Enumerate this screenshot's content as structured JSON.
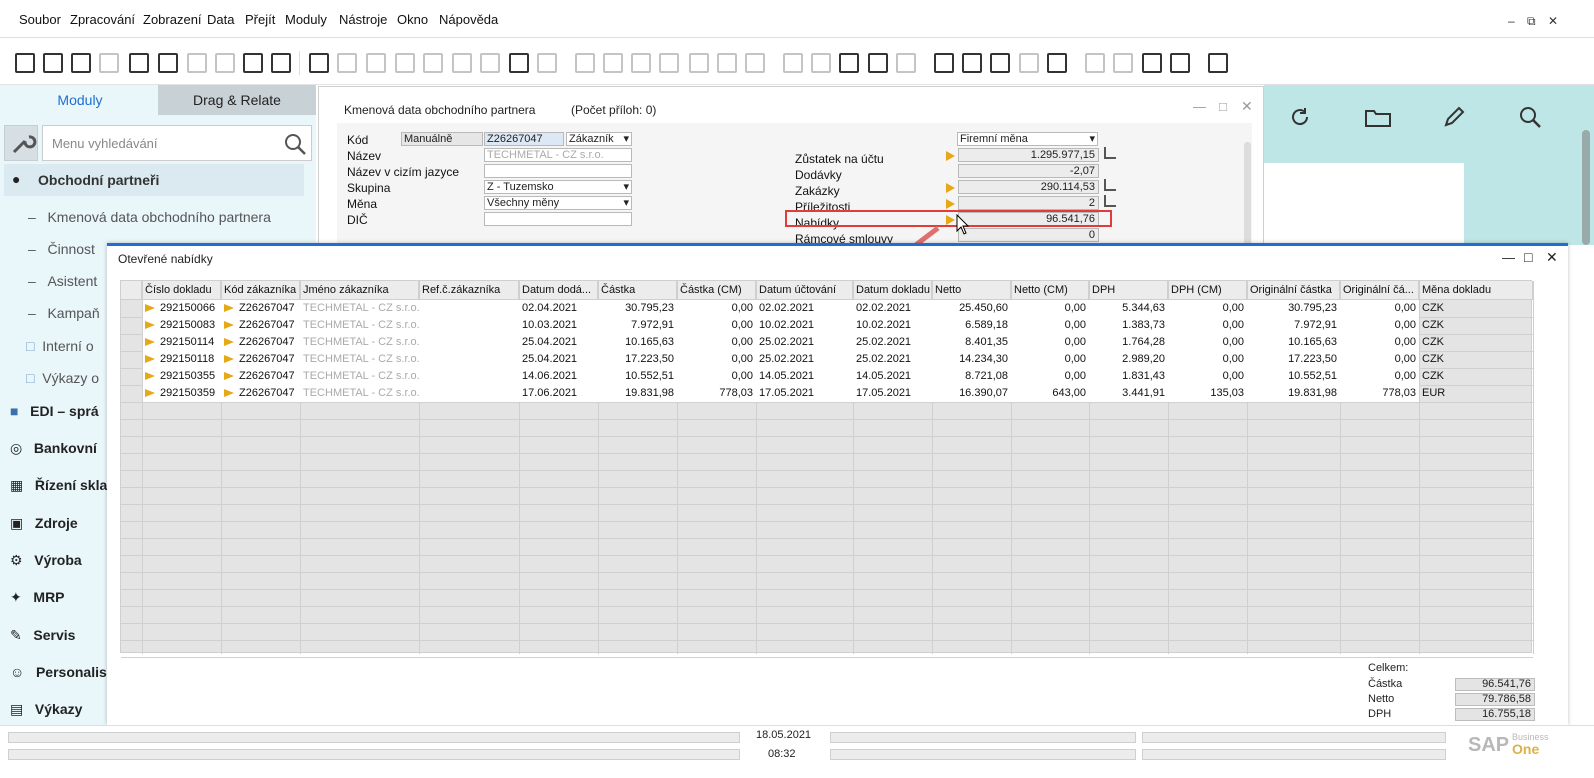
{
  "menu": [
    "Soubor",
    "Zpracování",
    "Zobrazení",
    "Data",
    "Přejít",
    "Moduly",
    "Nástroje",
    "Okno",
    "Nápověda"
  ],
  "window_controls": {
    "minimize": "–",
    "restore": "⧉",
    "close": "✕"
  },
  "sidebar": {
    "tab_modules": "Moduly",
    "tab_drag": "Drag & Relate",
    "search_placeholder": "Menu vyhledávání",
    "module": "Obchodní partneři",
    "sub_items": [
      "Kmenová data obchodního partnera",
      "Činnost",
      "Asistent",
      "Kampaň"
    ],
    "folders": [
      "Interní o",
      "Výkazy o"
    ],
    "modules": [
      "EDI – sprá",
      "Bankovní",
      "Řízení skla",
      "Zdroje",
      "Výroba",
      "MRP",
      "Servis",
      "Personalis",
      "Výkazy"
    ]
  },
  "bp_window": {
    "title": "Kmenová data obchodního partnera",
    "attachments": "(Počet příloh: 0)",
    "labels": {
      "kod": "Kód",
      "nazev": "Název",
      "nazev_cizi": "Název v cizím jazyce",
      "skupina": "Skupina",
      "mena": "Měna",
      "dic": "DIČ"
    },
    "values": {
      "manual": "Manuálně",
      "kod": "Z26267047",
      "typ": "Zákazník",
      "nazev": "TECHMETAL - CZ s.r.o.",
      "skupina": "Z - Tuzemsko",
      "mena": "Všechny měny"
    },
    "currency_select": "Firemní měna",
    "balances": [
      {
        "label": "Zůstatek na účtu",
        "value": "1.295.977,15"
      },
      {
        "label": "Dodávky",
        "value": "-2,07"
      },
      {
        "label": "Zakázky",
        "value": "290.114,53"
      },
      {
        "label": "Příležitosti",
        "value": "2"
      },
      {
        "label": "Nabídky",
        "value": "96.541,76"
      },
      {
        "label": "Rámcové smlouvy",
        "value": "0"
      }
    ]
  },
  "offers_window": {
    "title": "Otevřené nabídky",
    "columns": [
      "Číslo dokladu",
      "Kód zákazníka",
      "Jméno zákazníka",
      "Ref.č.zákazníka",
      "Datum dodá...",
      "Částka",
      "Částka (CM)",
      "Datum účtování",
      "Datum dokladu",
      "Netto",
      "Netto (CM)",
      "DPH",
      "DPH (CM)",
      "Originální částka",
      "Originální čá...",
      "Měna dokladu"
    ],
    "rows": [
      [
        "292150066",
        "Z26267047",
        "TECHMETAL - CZ s.r.o.",
        "",
        "02.04.2021",
        "30.795,23",
        "0,00",
        "02.02.2021",
        "02.02.2021",
        "25.450,60",
        "0,00",
        "5.344,63",
        "0,00",
        "30.795,23",
        "0,00",
        "CZK"
      ],
      [
        "292150083",
        "Z26267047",
        "TECHMETAL - CZ s.r.o.",
        "",
        "10.03.2021",
        "7.972,91",
        "0,00",
        "10.02.2021",
        "10.02.2021",
        "6.589,18",
        "0,00",
        "1.383,73",
        "0,00",
        "7.972,91",
        "0,00",
        "CZK"
      ],
      [
        "292150114",
        "Z26267047",
        "TECHMETAL - CZ s.r.o.",
        "",
        "25.04.2021",
        "10.165,63",
        "0,00",
        "25.02.2021",
        "25.02.2021",
        "8.401,35",
        "0,00",
        "1.764,28",
        "0,00",
        "10.165,63",
        "0,00",
        "CZK"
      ],
      [
        "292150118",
        "Z26267047",
        "TECHMETAL - CZ s.r.o.",
        "",
        "25.04.2021",
        "17.223,50",
        "0,00",
        "25.02.2021",
        "25.02.2021",
        "14.234,30",
        "0,00",
        "2.989,20",
        "0,00",
        "17.223,50",
        "0,00",
        "CZK"
      ],
      [
        "292150355",
        "Z26267047",
        "TECHMETAL - CZ s.r.o.",
        "",
        "14.06.2021",
        "10.552,51",
        "0,00",
        "14.05.2021",
        "14.05.2021",
        "8.721,08",
        "0,00",
        "1.831,43",
        "0,00",
        "10.552,51",
        "0,00",
        "CZK"
      ],
      [
        "292150359",
        "Z26267047",
        "TECHMETAL - CZ s.r.o.",
        "",
        "17.06.2021",
        "19.831,98",
        "778,03",
        "17.05.2021",
        "17.05.2021",
        "16.390,07",
        "643,00",
        "3.441,91",
        "135,03",
        "19.831,98",
        "778,03",
        "EUR"
      ]
    ],
    "totals": {
      "heading": "Celkem:",
      "castka_label": "Částka",
      "castka": "96.541,76",
      "netto_label": "Netto",
      "netto": "79.786,58",
      "dph_label": "DPH",
      "dph": "16.755,18"
    }
  },
  "status": {
    "date": "18.05.2021",
    "time": "08:32",
    "brand": "SAP",
    "brand_sub1": "Business",
    "brand_sub2": "One"
  },
  "colors": {
    "accent": "#1f6fd1",
    "arrow": "#e6a817",
    "highlight": "#e23b3b",
    "sidebar": "#e9f6fa",
    "panel": "#bfe6e6"
  }
}
